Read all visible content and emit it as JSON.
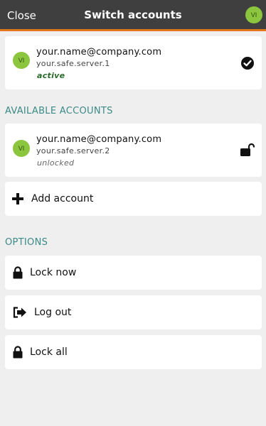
{
  "header": {
    "close_label": "Close",
    "title": "Switch accounts",
    "avatar_initials": "VI"
  },
  "current_account": {
    "initials": "VI",
    "email": "your.name@company.com",
    "server": "your.safe.server.1",
    "status": "active"
  },
  "available_section_title": "AVAILABLE ACCOUNTS",
  "available_accounts": [
    {
      "initials": "VI",
      "email": "your.name@company.com",
      "server": "your.safe.server.2",
      "status": "unlocked"
    }
  ],
  "add_account_label": "Add account",
  "options_section_title": "OPTIONS",
  "options": [
    {
      "label": "Lock now",
      "icon": "lock-icon"
    },
    {
      "label": "Log out",
      "icon": "logout-icon"
    },
    {
      "label": "Lock all",
      "icon": "lock-icon"
    }
  ],
  "colors": {
    "header_bg": "#3f3f3f",
    "header_accent": "#e4761b",
    "avatar_bg": "#8cc63f",
    "section_title": "#3a8a86",
    "active_status": "#2a6a2a"
  }
}
